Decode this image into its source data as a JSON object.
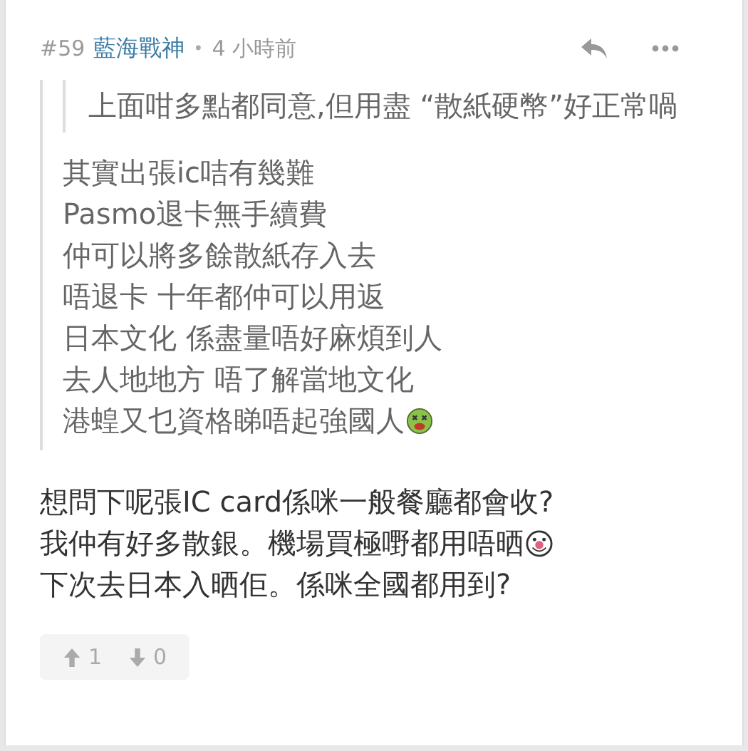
{
  "comment": {
    "number": "#59",
    "author": "藍海戰神",
    "separator": "•",
    "time": "4 小時前",
    "quote": {
      "nested_quote": "上面咁多點都同意,但用盡 “散紙硬幣”好正常喎",
      "lines": [
        {
          "text": "其實出張ic咭有幾難"
        },
        {
          "text": "Pasmo退卡無手續費"
        },
        {
          "text": "仲可以將多餘散紙存入去"
        },
        {
          "text": "唔退卡 十年都仲可以用返"
        },
        {
          "text": "日本文化 係盡量唔好麻煩到人"
        },
        {
          "text": "去人地地方 唔了解當地文化"
        },
        {
          "text": "港蝗又乜資格睇唔起強國人",
          "emoji": {
            "kind": "sick"
          }
        }
      ]
    },
    "body": [
      {
        "text": "想問下呢張IC card係咪一般餐廳都會收?"
      },
      {
        "text": "我仲有好多散銀。機場買極嘢都用唔晒",
        "emoji": {
          "kind": "clown"
        }
      },
      {
        "text": "下次去日本入晒佢。係咪全國都用到?"
      }
    ],
    "upvotes": "1",
    "downvotes": "0"
  }
}
